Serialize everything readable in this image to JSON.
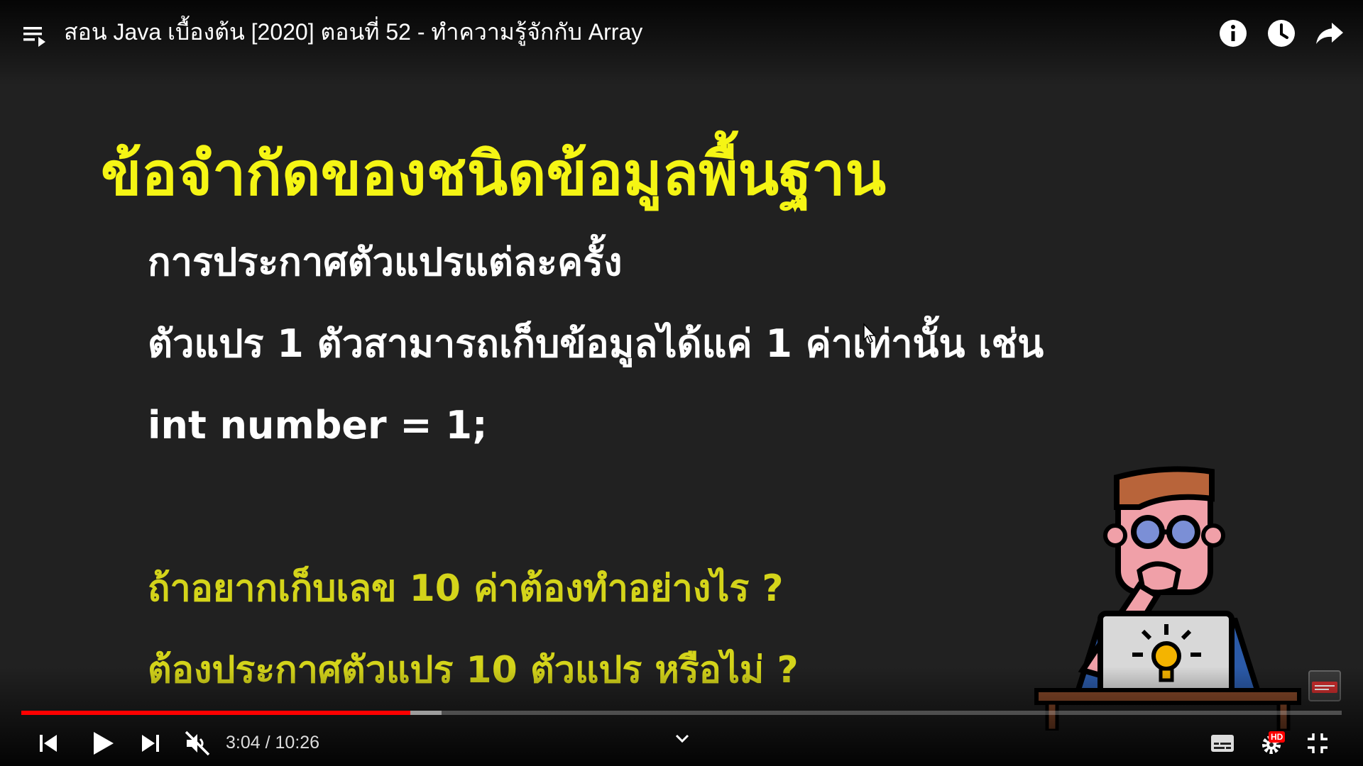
{
  "player": {
    "title": "สอน Java เบื้องต้น [2020] ตอนที่ 52 - ทำความรู้จักกับ Array",
    "time_current": "3:04",
    "time_separator": " / ",
    "time_total": "10:26",
    "played_fraction": 0.2944,
    "buffered_fraction": 0.3182,
    "hd_label": "HD",
    "colors": {
      "progress": "#ff0000",
      "heading": "#f5f514",
      "question": "#d4d41a",
      "body_text": "#ffffff"
    },
    "icons": [
      "playlist-icon",
      "info-icon",
      "watch-later-icon",
      "share-icon",
      "previous-icon",
      "play-icon",
      "next-icon",
      "muted-speaker-icon",
      "chevron-down-icon",
      "subtitles-icon",
      "gear-icon",
      "exit-fullscreen-icon"
    ]
  },
  "slide": {
    "heading": "ข้อจำกัดของชนิดข้อมูลพื้นฐาน",
    "line1": "การประกาศตัวแปรแต่ละครั้ง",
    "line2": "ตัวแปร 1 ตัวสามารถเก็บข้อมูลได้แค่ 1 ค่าเท่านั้น เช่น",
    "code": "int number = 1;",
    "question1": "ถ้าอยากเก็บเลข 10 ค่าต้องทำอย่างไร ?",
    "question2": "ต้องประกาศตัวแปร 10 ตัวแปร หรือไม่ ?"
  }
}
